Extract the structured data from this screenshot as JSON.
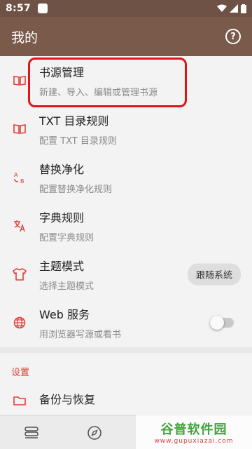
{
  "status_bar": {
    "time": "8:57"
  },
  "app_bar": {
    "title": "我的"
  },
  "items": [
    {
      "title": "书源管理",
      "subtitle": "新建、导入、编辑或管理书源",
      "icon": "book-icon"
    },
    {
      "title": "TXT 目录规则",
      "subtitle": "配置 TXT 目录规则",
      "icon": "book-icon"
    },
    {
      "title": "替换净化",
      "subtitle": "配置替换净化规则",
      "icon": "replace-icon"
    },
    {
      "title": "字典规则",
      "subtitle": "配置字典规则",
      "icon": "translate-icon"
    },
    {
      "title": "主题模式",
      "subtitle": "选择主题模式",
      "icon": "shirt-icon",
      "chip": "跟随系统"
    },
    {
      "title": "Web 服务",
      "subtitle": "用浏览器写源或看书",
      "icon": "globe-icon",
      "switch_on": false
    }
  ],
  "settings": {
    "section_title": "设置",
    "backup": {
      "title": "备份与恢复",
      "icon": "folder-icon"
    }
  },
  "watermark": {
    "brand": "谷普软件园",
    "url": "www.gupuxiazai.com"
  },
  "colors": {
    "primary": "#7a5a4a",
    "accent": "#e0403a",
    "highlight": "#e0141a"
  }
}
